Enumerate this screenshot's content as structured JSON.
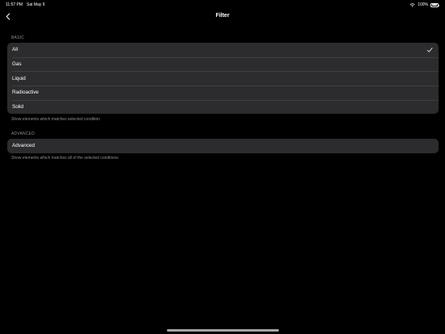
{
  "status_bar": {
    "time": "11:57 PM",
    "date": "Sat May 9",
    "battery": "100%",
    "battery_level": 1.0
  },
  "nav": {
    "title": "Filter",
    "back_icon": "chevron-left-icon"
  },
  "basic": {
    "header": "BASIC",
    "footer": "Show elements which matches selected condition",
    "items": [
      {
        "label": "All",
        "selected": true
      },
      {
        "label": "Gas",
        "selected": false
      },
      {
        "label": "Liquid",
        "selected": false
      },
      {
        "label": "Radioactive",
        "selected": false
      },
      {
        "label": "Solid",
        "selected": false
      }
    ]
  },
  "advanced": {
    "header": "ADVANCED",
    "footer": "Show elements which matches all of the selected conditions",
    "items": [
      {
        "label": "Advanced"
      }
    ]
  },
  "colors": {
    "background": "#000000",
    "cell": "#2c2c2e",
    "secondary_text": "#8d8d92"
  }
}
